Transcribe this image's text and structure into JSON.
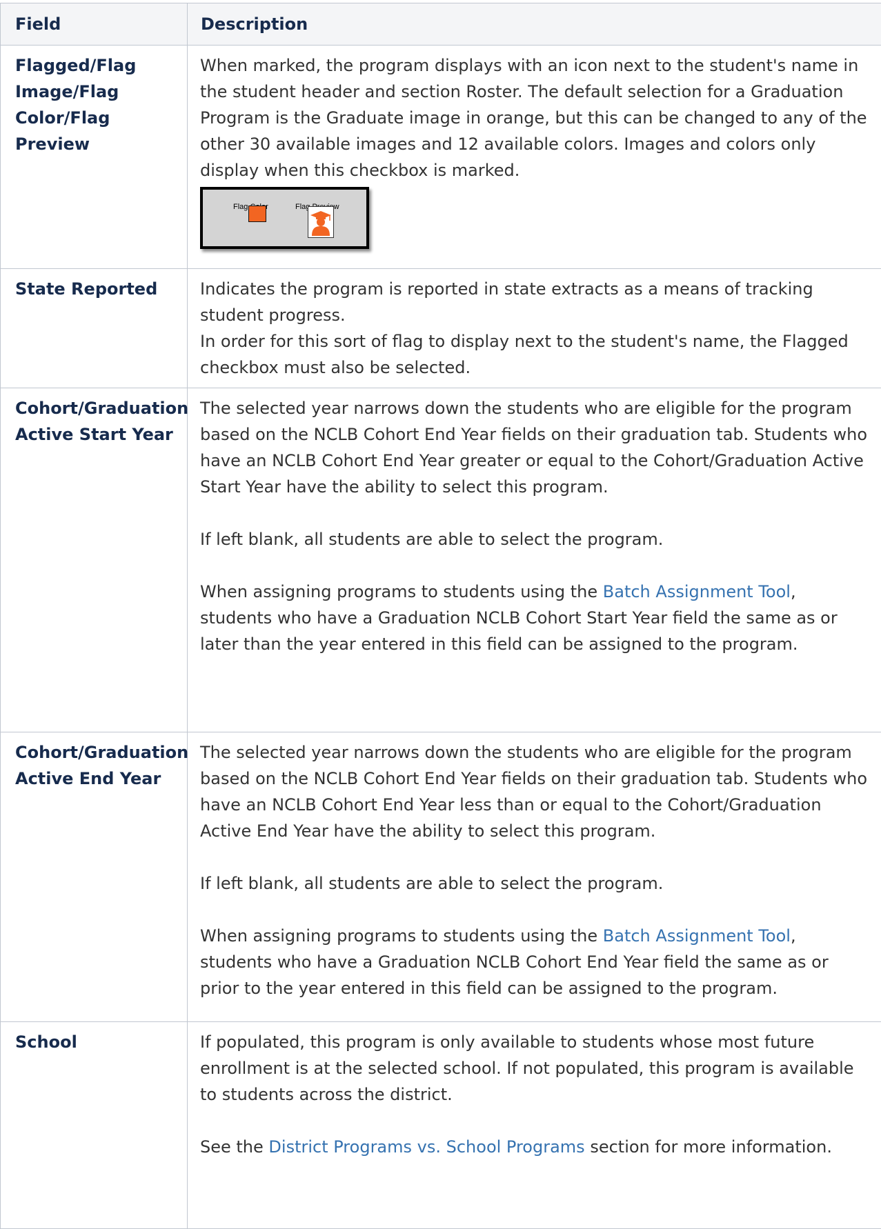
{
  "table": {
    "headers": {
      "field": "Field",
      "description": "Description"
    },
    "rows": [
      {
        "field": "Flagged/Flag Image/Flag Color/Flag Preview",
        "paragraphs": [
          "When marked, the program displays with an icon next to the student's name in the student header and section Roster. The default selection for a Graduation Program is the Graduate image in orange, but this can be changed to any of the other 30 available images and 12 available colors. Images and colors only display when this checkbox is marked."
        ],
        "figure": {
          "flag_color_label": "Flag Color",
          "flag_preview_label": "Flag Preview",
          "swatch_color": "#f26522",
          "icon": "graduate-icon"
        }
      },
      {
        "field": "State Reported",
        "paragraphs": [
          "Indicates the program is reported in state extracts as a means of tracking student progress.",
          "In order for this sort of flag to display next to the student's name, the Flagged checkbox must also be selected."
        ]
      },
      {
        "field": "Cohort/Graduation Active Start Year",
        "paragraphs": [
          "The selected year narrows down the students who are eligible for the program based on the NCLB Cohort End Year fields on their graduation tab. Students who have an NCLB Cohort End Year greater or equal to the Cohort/Graduation Active Start Year have the ability to select this program.",
          "If left blank, all students are able to select the program."
        ],
        "batch": {
          "before": "When assigning programs to students using the ",
          "link": "Batch Assignment Tool",
          "after": ", students who have a Graduation NCLB Cohort Start Year field the same as or later than the year entered in this field can be assigned to the program."
        }
      },
      {
        "field": "Cohort/Graduation Active End Year",
        "paragraphs": [
          "The selected year narrows down the students who are eligible for the program based on the NCLB Cohort End Year fields on their graduation tab. Students who have an NCLB Cohort End Year less than or equal to the Cohort/Graduation Active End Year have the ability to select this program.",
          "If left blank, all students are able to select the program."
        ],
        "batch": {
          "before": "When assigning programs to students using the ",
          "link": "Batch Assignment Tool",
          "after": ", students who have a Graduation NCLB Cohort End Year field the same as or prior to the year entered in this field can be assigned to the program."
        }
      },
      {
        "field": "School",
        "paragraphs": [
          "If populated, this program is only available to students whose most future enrollment is at the selected school. If not populated, this program is available to students across the district."
        ],
        "see": {
          "before": "See the ",
          "link": "District Programs vs. School Programs",
          "after": " section for more information."
        }
      }
    ]
  },
  "colors": {
    "header_bg": "#f4f5f7",
    "heading_text": "#172b4d",
    "body_text": "#333333",
    "link": "#3572b0",
    "border": "#c1c7d0"
  }
}
